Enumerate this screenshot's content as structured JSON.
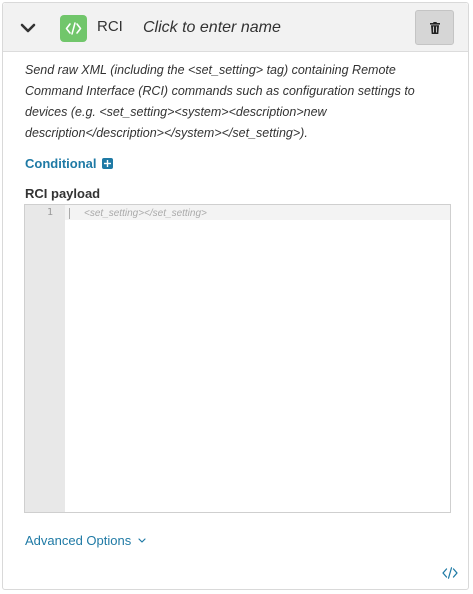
{
  "header": {
    "type_label": "RCI",
    "name_placeholder": "Click to enter name",
    "badge_color": "#71c66b"
  },
  "description": "Send raw XML (including the <set_setting> tag) containing Remote Command Interface (RCI) commands such as configuration settings to devices (e.g. <set_setting><system><description>new description</description></system></set_setting>).",
  "conditional": {
    "label": "Conditional"
  },
  "payload": {
    "label": "RCI payload",
    "line_number": "1",
    "placeholder": "<set_setting></set_setting>"
  },
  "advanced": {
    "label": "Advanced Options"
  },
  "colors": {
    "accent": "#1f7aa5"
  }
}
